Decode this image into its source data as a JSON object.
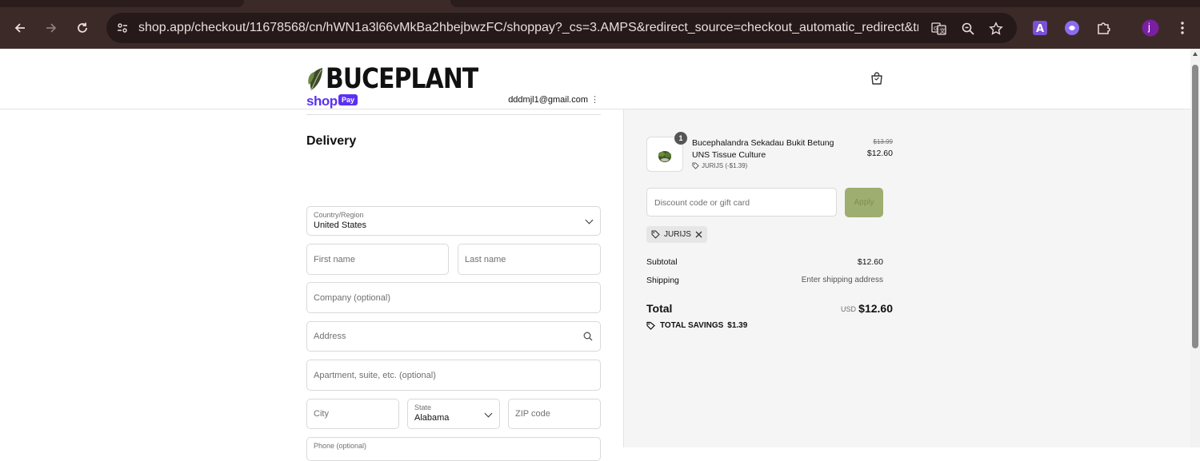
{
  "browser": {
    "url": "shop.app/checkout/11678568/cn/hWN1a3l66vMkBa2hbejbwzFC/shoppay?_cs=3.AMPS&redirect_source=checkout_automatic_redirect&tracki...",
    "profile_initial": "j"
  },
  "header": {
    "brand": "BUCEPLANT"
  },
  "shop_pay": {
    "logo": "shop",
    "badge": "Pay",
    "email": "dddmjl1@gmail.com"
  },
  "delivery": {
    "title": "Delivery",
    "country_label": "Country/Region",
    "country_value": "United States",
    "first_name_ph": "First name",
    "last_name_ph": "Last name",
    "company_ph": "Company (optional)",
    "address_ph": "Address",
    "apartment_ph": "Apartment, suite, etc. (optional)",
    "city_ph": "City",
    "state_label": "State",
    "state_value": "Alabama",
    "zip_ph": "ZIP code",
    "phone_ph": "Phone (optional)"
  },
  "order": {
    "quantity": "1",
    "product_name": "Bucephalandra Sekadau Bukit Betung UNS Tissue Culture",
    "product_discount": "JURIJS (-$1.39)",
    "price_original": "$13.99",
    "price_now": "$12.60",
    "discount_placeholder": "Discount code or gift card",
    "apply_label": "Apply",
    "applied_code": "JURIJS",
    "subtotal_label": "Subtotal",
    "subtotal_value": "$12.60",
    "shipping_label": "Shipping",
    "shipping_value": "Enter shipping address",
    "total_label": "Total",
    "total_currency": "USD",
    "total_value": "$12.60",
    "savings_label": "TOTAL SAVINGS",
    "savings_value": "$1.39"
  },
  "colors": {
    "shop_purple": "#5a31f4",
    "apply_green": "#9ead70",
    "chrome_bg": "#3c2a28"
  }
}
